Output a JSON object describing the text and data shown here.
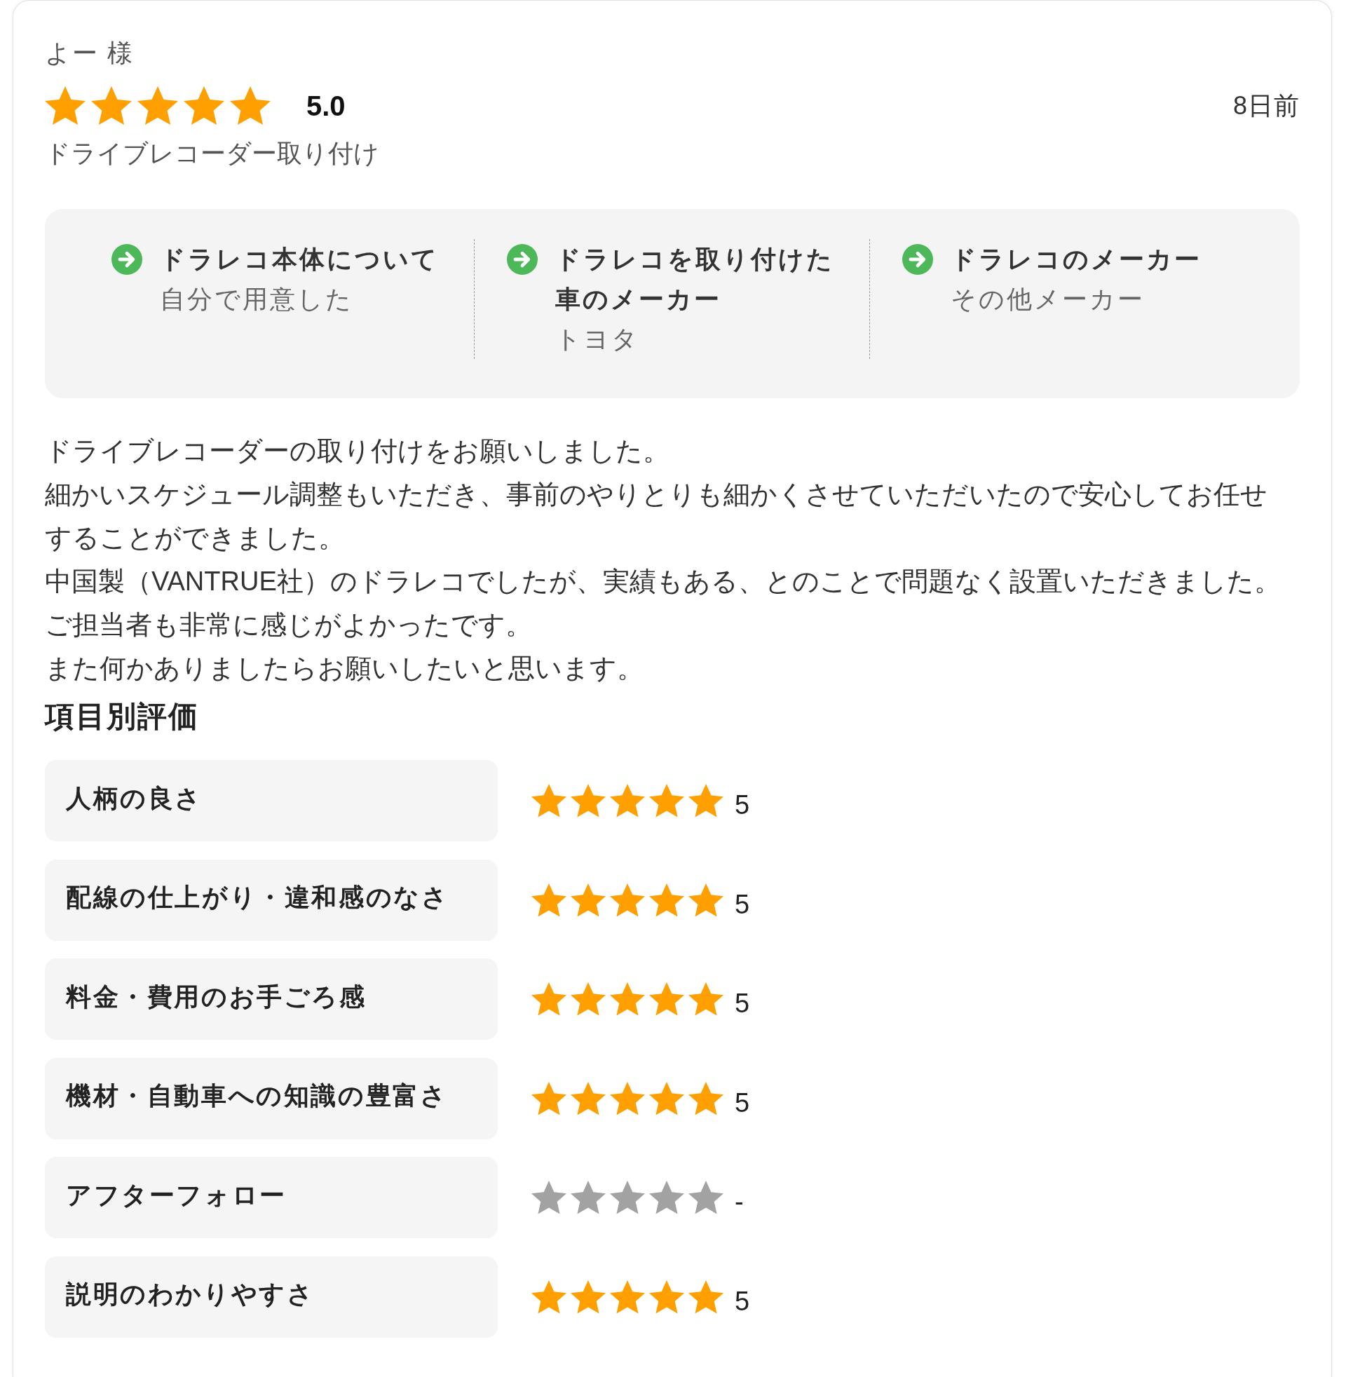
{
  "reviewer": "よー 様",
  "rating": {
    "stars": 5,
    "score": "5.0"
  },
  "date": "8日前",
  "service": "ドライブレコーダー取り付け",
  "details": [
    {
      "title": "ドラレコ本体について",
      "value": "自分で用意した"
    },
    {
      "title": "ドラレコを取り付けた車のメーカー",
      "value": "トヨタ"
    },
    {
      "title": "ドラレコのメーカー",
      "value": "その他メーカー"
    }
  ],
  "comment": [
    "ドライブレコーダーの取り付けをお願いしました。",
    "細かいスケジュール調整もいただき、事前のやりとりも細かくさせていただいたので安心してお任せすることができました。",
    "中国製（VANTRUE社）のドラレコでしたが、実績もある、とのことで問題なく設置いただきました。",
    "ご担当者も非常に感じがよかったです。",
    "また何かありましたらお願いしたいと思います。"
  ],
  "item_ratings": {
    "heading": "項目別評価",
    "items": [
      {
        "label": "人柄の良さ",
        "rated": true,
        "stars": 5,
        "score": "5"
      },
      {
        "label": "配線の仕上がり・違和感のなさ",
        "rated": true,
        "stars": 5,
        "score": "5"
      },
      {
        "label": "料金・費用のお手ごろ感",
        "rated": true,
        "stars": 5,
        "score": "5"
      },
      {
        "label": "機材・自動車への知識の豊富さ",
        "rated": true,
        "stars": 5,
        "score": "5"
      },
      {
        "label": "アフターフォロー",
        "rated": false,
        "score": "-"
      },
      {
        "label": "説明のわかりやすさ",
        "rated": true,
        "stars": 5,
        "score": "5"
      }
    ]
  }
}
